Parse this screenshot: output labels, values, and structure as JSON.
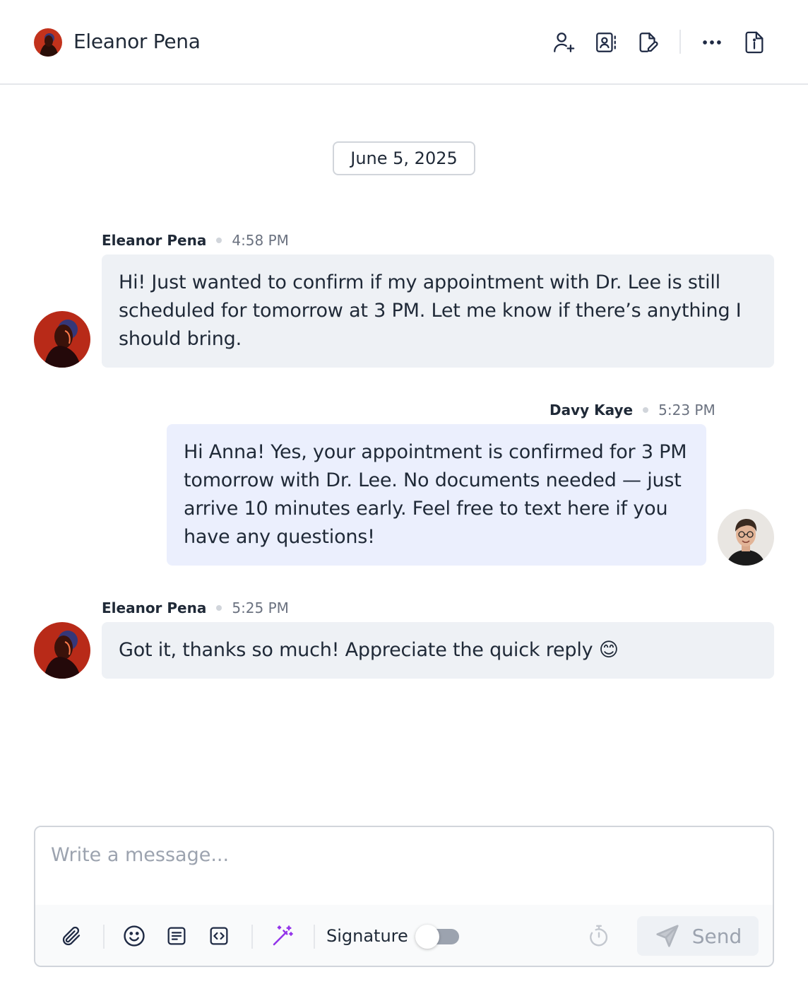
{
  "header": {
    "contact_name": "Eleanor Pena",
    "icons": [
      "add-contact-icon",
      "contact-card-icon",
      "edit-note-icon",
      "more-icon",
      "file-info-icon"
    ]
  },
  "conversation": {
    "date": "June 5, 2025",
    "messages": [
      {
        "sender": "Eleanor Pena",
        "time": "4:58 PM",
        "direction": "incoming",
        "text": "Hi! Just wanted to confirm if my appointment with Dr. Lee is still scheduled for tomorrow at 3 PM. Let me know if there’s anything I should bring."
      },
      {
        "sender": "Davy Kaye",
        "time": "5:23 PM",
        "direction": "outgoing",
        "text": "Hi Anna! Yes, your appointment is confirmed for 3 PM tomorrow with Dr. Lee. No documents needed — just arrive 10 minutes early. Feel free to text here if you have any questions!"
      },
      {
        "sender": "Eleanor Pena",
        "time": "5:25 PM",
        "direction": "incoming",
        "text": "Got it, thanks so much! Appreciate the quick reply 😊"
      }
    ]
  },
  "composer": {
    "placeholder": "Write a message...",
    "value": "",
    "signature_label": "Signature",
    "signature_enabled": false,
    "send_label": "Send"
  },
  "colors": {
    "incoming_bubble": "#eef1f5",
    "outgoing_bubble": "#ebeffd",
    "ai_accent": "#9333ea"
  }
}
